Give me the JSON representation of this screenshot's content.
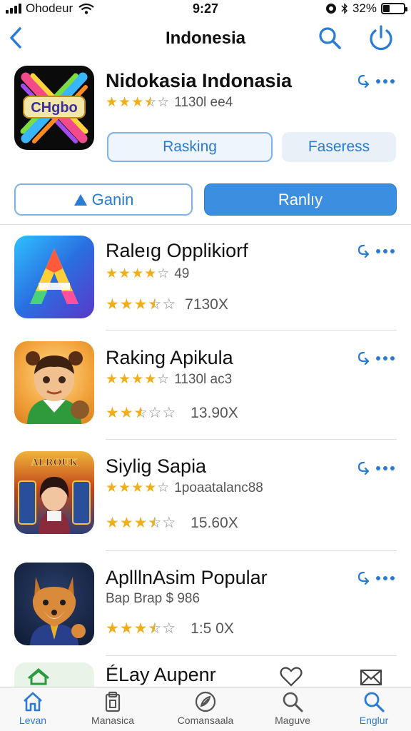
{
  "status_bar": {
    "carrier": "Ohodeur",
    "time": "9:27",
    "battery": "32%",
    "battery_level": 0.32
  },
  "nav": {
    "title": "Indonesia"
  },
  "colors": {
    "accent": "#2a7bd3",
    "accent_fill": "#3b8ee0",
    "star": "#f0ae1a"
  },
  "featured": {
    "icon_text": "CHgbo",
    "name": "Nidokasia Indonasia",
    "stars": 3.5,
    "meta": "1130l ee4",
    "buttons": {
      "primary": "Rasking",
      "secondary": "Faseress"
    }
  },
  "segments": {
    "left": "Ganin",
    "right": "Ranlıy"
  },
  "list": [
    {
      "name": "Raleıg Opplikiorf",
      "stars": 4,
      "sub": "49",
      "stars2": 3.5,
      "meta2": "7130X",
      "icon": "a-logo-icon"
    },
    {
      "name": "Raking Apikula",
      "stars": 4,
      "sub": "1130l ac3",
      "stars2": 2.5,
      "meta2": "13.90X",
      "icon": "boy-character-icon"
    },
    {
      "name": "Siylig Sapia",
      "stars": 4,
      "sub": "1poaatalanc88",
      "stars2": 3.5,
      "meta2": "15.60X",
      "icon": "girl-game-icon",
      "icon_text": "ALROUK"
    },
    {
      "name": "AplllnAsim Popular",
      "sub_text": "Bap Brap $ 986",
      "stars2": 3.5,
      "meta2": "1:5 0X",
      "icon": "fox-character-icon"
    }
  ],
  "partial_item": {
    "name": "ÉLay Aupenr"
  },
  "tabs": [
    {
      "label": "Levan",
      "icon": "home-icon",
      "active": true
    },
    {
      "label": "Manasica",
      "icon": "clipboard-icon",
      "active": false
    },
    {
      "label": "Comansaala",
      "icon": "rocket-icon",
      "active": false
    },
    {
      "label": "Maguve",
      "icon": "search-icon",
      "active": false
    },
    {
      "label": "Englur",
      "icon": "search-icon",
      "active": true
    }
  ]
}
